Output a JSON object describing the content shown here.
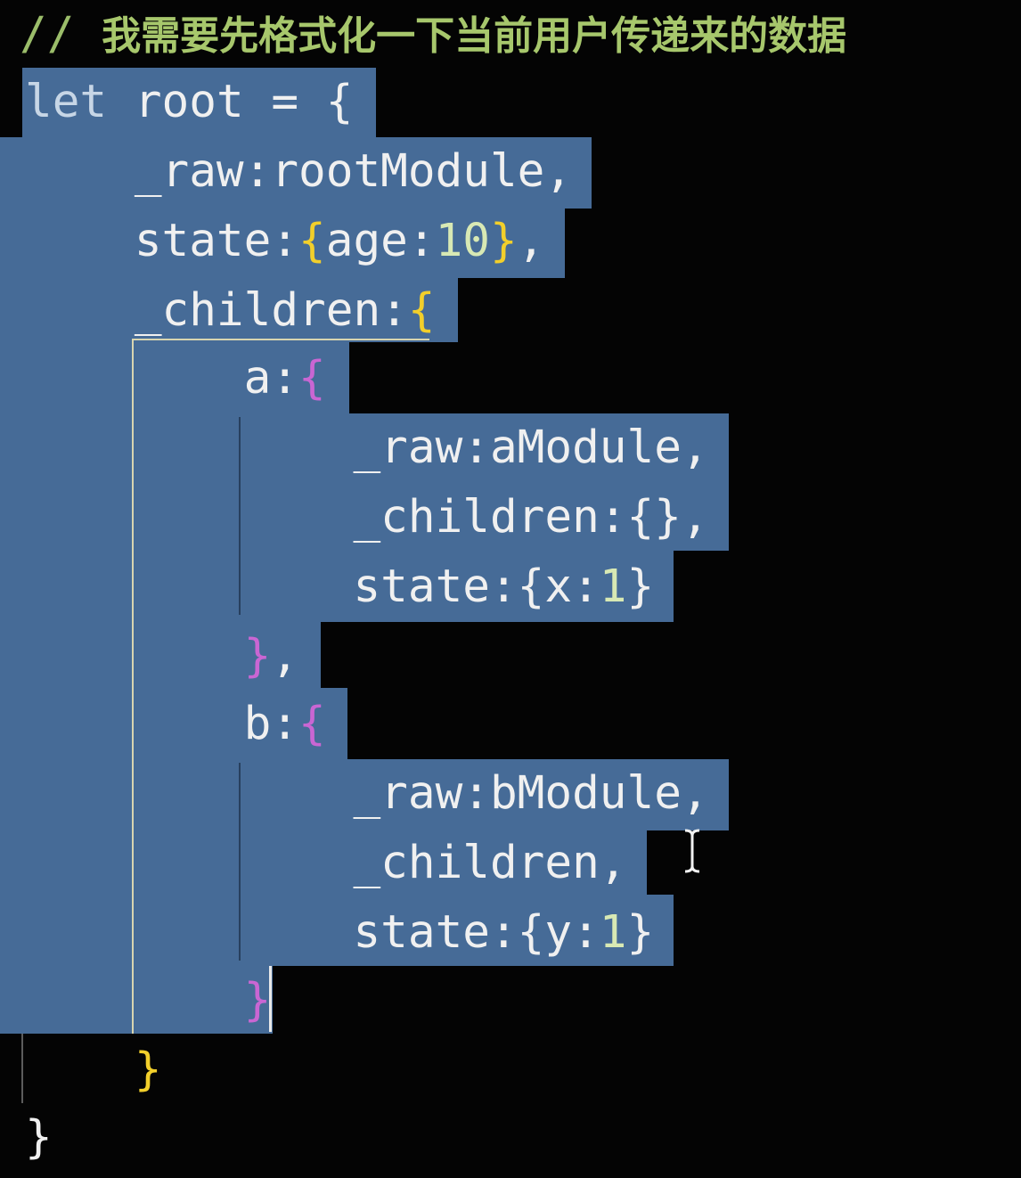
{
  "editor": {
    "lines": [
      [
        {
          "text": "// ",
          "kind": "comment"
        },
        {
          "text": "我需要先格式化一下当前用户传递来的数据",
          "kind": "cjk"
        }
      ],
      [
        {
          "text": "let",
          "kind": "keyword"
        },
        {
          "text": " root = ",
          "kind": "plain"
        },
        {
          "text": "{",
          "kind": "plain"
        }
      ],
      [
        {
          "text": "    _raw:rootModule,",
          "kind": "plain"
        }
      ],
      [
        {
          "text": "    state:",
          "kind": "plain"
        },
        {
          "text": "{",
          "kind": "brace-y"
        },
        {
          "text": "age:",
          "kind": "plain"
        },
        {
          "text": "10",
          "kind": "number"
        },
        {
          "text": "}",
          "kind": "brace-y"
        },
        {
          "text": ",",
          "kind": "plain"
        }
      ],
      [
        {
          "text": "    _children:",
          "kind": "plain"
        },
        {
          "text": "{",
          "kind": "brace-y"
        }
      ],
      [
        {
          "text": "        a:",
          "kind": "plain"
        },
        {
          "text": "{",
          "kind": "brace-p"
        }
      ],
      [
        {
          "text": "            _raw:aModule,",
          "kind": "plain"
        }
      ],
      [
        {
          "text": "            _children:{},",
          "kind": "plain"
        }
      ],
      [
        {
          "text": "            state:{x:",
          "kind": "plain"
        },
        {
          "text": "1",
          "kind": "number"
        },
        {
          "text": "}",
          "kind": "plain"
        }
      ],
      [
        {
          "text": "        ",
          "kind": "plain"
        },
        {
          "text": "}",
          "kind": "brace-p"
        },
        {
          "text": ",",
          "kind": "plain"
        }
      ],
      [
        {
          "text": "        b:",
          "kind": "plain"
        },
        {
          "text": "{",
          "kind": "brace-p"
        }
      ],
      [
        {
          "text": "            _raw:bModule,",
          "kind": "plain"
        }
      ],
      [
        {
          "text": "            _children,",
          "kind": "plain"
        }
      ],
      [
        {
          "text": "            state:{y:",
          "kind": "plain"
        },
        {
          "text": "1",
          "kind": "number"
        },
        {
          "text": "}",
          "kind": "plain"
        }
      ],
      [
        {
          "text": "        ",
          "kind": "plain"
        },
        {
          "text": "}",
          "kind": "brace-p"
        }
      ],
      [
        {
          "text": "    ",
          "kind": "plain"
        },
        {
          "text": "}",
          "kind": "brace-y"
        }
      ],
      [
        {
          "text": "}",
          "kind": "plain"
        }
      ]
    ]
  },
  "colors": {
    "background": "#040404",
    "selection": "#466b97",
    "comment": "#9bbd6a",
    "brace_yellow": "#f2cf2b",
    "brace_purple": "#c966d3",
    "number": "#d8e9b4",
    "text": "#f0f0f0"
  },
  "icons": {
    "mouse_pointer": "i-beam-cursor-icon",
    "text_caret": "text-caret"
  }
}
